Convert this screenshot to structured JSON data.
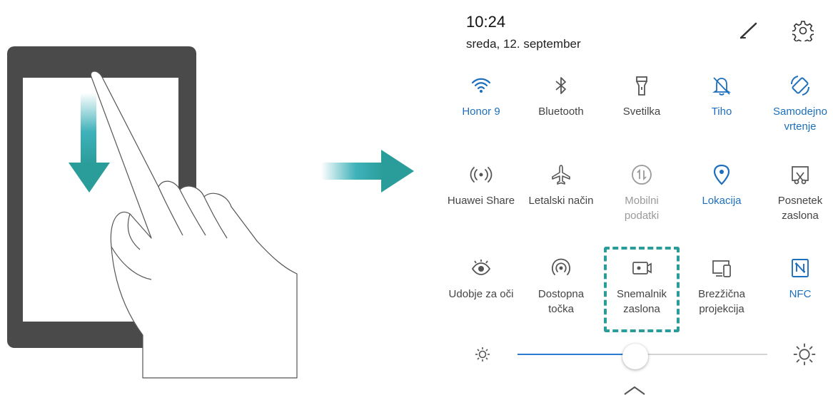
{
  "status": {
    "time": "10:24",
    "date": "sreda, 12. september"
  },
  "header_icons": [
    "edit-pencil-icon",
    "settings-gear-icon"
  ],
  "tiles": [
    {
      "label": "Honor 9",
      "icon": "wifi-icon",
      "state": "active"
    },
    {
      "label": "Bluetooth",
      "icon": "bluetooth-icon",
      "state": "inactive"
    },
    {
      "label": "Svetilka",
      "icon": "flashlight-icon",
      "state": "inactive"
    },
    {
      "label": "Tiho",
      "icon": "silent-bell-icon",
      "state": "active"
    },
    {
      "label": "Samodejno vrtenje",
      "icon": "auto-rotate-icon",
      "state": "active"
    },
    {
      "label": "Huawei Share",
      "icon": "huawei-share-icon",
      "state": "inactive"
    },
    {
      "label": "Letalski način",
      "icon": "airplane-icon",
      "state": "inactive"
    },
    {
      "label": "Mobilni podatki",
      "icon": "mobile-data-icon",
      "state": "disabled"
    },
    {
      "label": "Lokacija",
      "icon": "location-icon",
      "state": "active"
    },
    {
      "label": "Posnetek zaslona",
      "icon": "screenshot-icon",
      "state": "inactive"
    },
    {
      "label": "Udobje za oči",
      "icon": "eye-comfort-icon",
      "state": "inactive"
    },
    {
      "label": "Dostopna točka",
      "icon": "hotspot-icon",
      "state": "inactive"
    },
    {
      "label": "Snemalnik zaslona",
      "icon": "screen-recorder-icon",
      "state": "inactive",
      "highlighted": true
    },
    {
      "label": "Brezžična projekcija",
      "icon": "wireless-projection-icon",
      "state": "inactive"
    },
    {
      "label": "NFC",
      "icon": "nfc-icon",
      "state": "active"
    }
  ],
  "brightness": {
    "level_percent": 47
  },
  "colors": {
    "active": "#1d6fbd",
    "inactive": "#444444",
    "disabled": "#9a9a9a",
    "highlight": "#2a9c9a",
    "arrow": "#2aa9b2",
    "phone_frame": "#4a4a4a"
  }
}
